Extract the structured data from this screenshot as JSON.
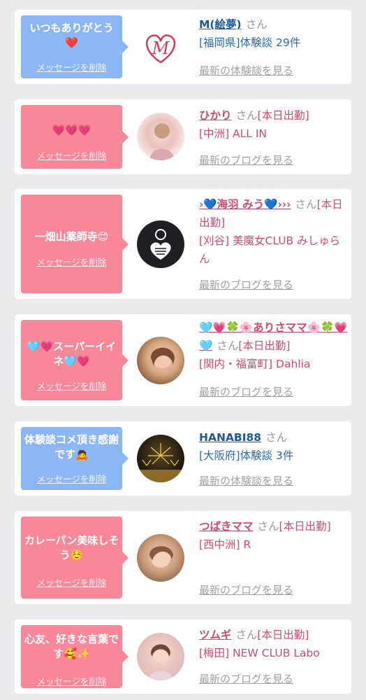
{
  "delete_label": "メッセージを削除",
  "cards": [
    {
      "bubble_color": "#8bb8f4",
      "message": "いつもありがとう ❤️",
      "name": "M(絵夢)",
      "san": "さん",
      "badge": "",
      "location": "[福岡県]体験談 29件",
      "link": "最新の体験談を見る",
      "avatar_icon": "heart-m-logo-icon"
    },
    {
      "bubble_color": "#f8879a",
      "message": "💗💗💗",
      "name": "ひかり",
      "san": "さん",
      "badge": "[本日出勤]",
      "location": "[中洲] ALL IN",
      "link": "最新のブログを見る",
      "avatar_icon": "avatar-photo-icon"
    },
    {
      "bubble_color": "#f8879a",
      "message": "一畑山薬師寺😊",
      "name": "›💙海羽 みう💙›››",
      "san": "さん",
      "badge": "[本日出勤]",
      "location": "[刈谷] 美魔女CLUB みしゅらん",
      "link": "最新のブログを見る",
      "avatar_icon": "heart-logo-avatar-icon"
    },
    {
      "bubble_color": "#f8879a",
      "message": "🩵💗スーパーイイネ🩵💗",
      "name": "🩵💗🍀🌸ありさママ🌸🍀💗🩵",
      "san": "さん",
      "badge": "[本日出勤]",
      "location": "[関内・福富町] Dahlia",
      "link": "最新のブログを見る",
      "avatar_icon": "avatar-photo-icon"
    },
    {
      "bubble_color": "#8bb8f4",
      "message": "体験談コメ頂き感謝です🙇",
      "name": "HANABI88",
      "san": "さん",
      "badge": "",
      "location": "[大阪府]体験談 3件",
      "link": "最新の体験談を見る",
      "avatar_icon": "fireworks-avatar-icon"
    },
    {
      "bubble_color": "#f8879a",
      "message": "カレーパン美味しそう☺️",
      "name": "つばきママ",
      "san": "さん",
      "badge": "[本日出勤]",
      "location": "[西中洲] R",
      "link": "最新のブログを見る",
      "avatar_icon": "avatar-photo-icon"
    },
    {
      "bubble_color": "#f8879a",
      "message": "心友、好きな言葉です🥰✨",
      "name": "ツムギ",
      "san": "さん",
      "badge": "[本日出勤]",
      "location": "[梅田] NEW CLUB Labo",
      "link": "最新のブログを見る",
      "avatar_icon": "avatar-photo-icon"
    }
  ]
}
